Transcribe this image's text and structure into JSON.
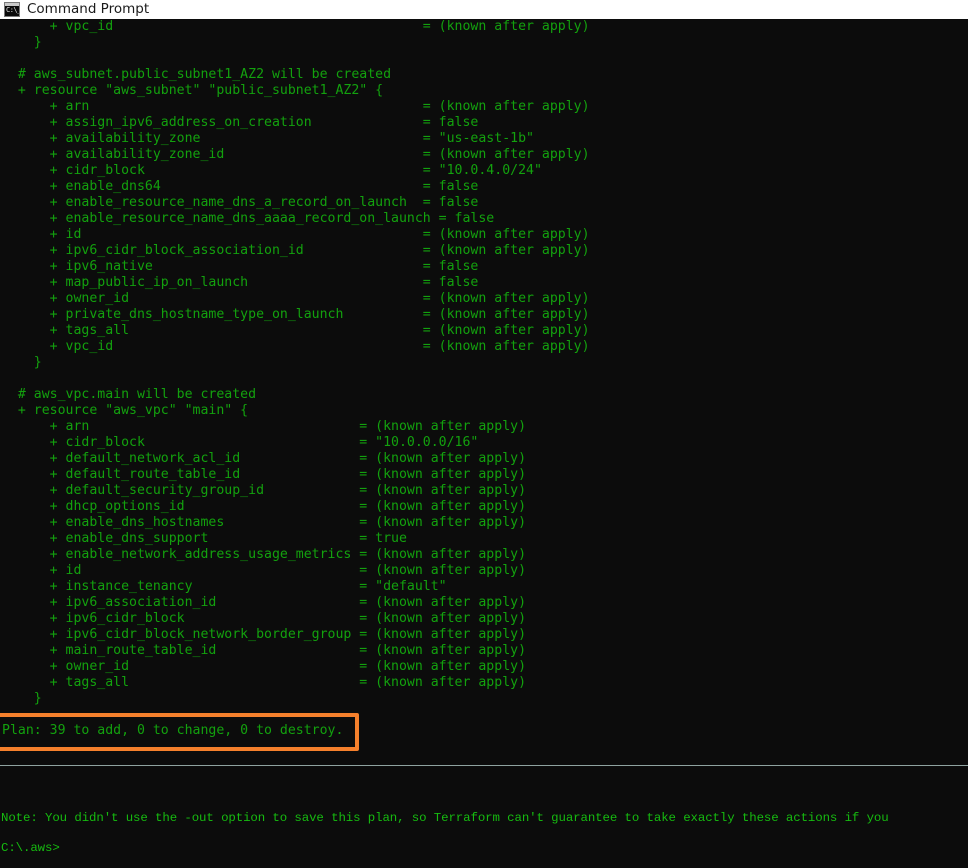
{
  "window": {
    "title": "Command Prompt",
    "icon": "command-prompt-icon",
    "icon_glyph": "C:\\_",
    "background": "#0c0c0c",
    "text_color": "#13a10e"
  },
  "terminal": {
    "lines": [
      "      + vpc_id                                       = (known after apply)",
      "    }",
      "",
      "  # aws_subnet.public_subnet1_AZ2 will be created",
      "  + resource \"aws_subnet\" \"public_subnet1_AZ2\" {",
      "      + arn                                          = (known after apply)",
      "      + assign_ipv6_address_on_creation              = false",
      "      + availability_zone                            = \"us-east-1b\"",
      "      + availability_zone_id                         = (known after apply)",
      "      + cidr_block                                   = \"10.0.4.0/24\"",
      "      + enable_dns64                                 = false",
      "      + enable_resource_name_dns_a_record_on_launch  = false",
      "      + enable_resource_name_dns_aaaa_record_on_launch = false",
      "      + id                                           = (known after apply)",
      "      + ipv6_cidr_block_association_id               = (known after apply)",
      "      + ipv6_native                                  = false",
      "      + map_public_ip_on_launch                      = false",
      "      + owner_id                                     = (known after apply)",
      "      + private_dns_hostname_type_on_launch          = (known after apply)",
      "      + tags_all                                     = (known after apply)",
      "      + vpc_id                                       = (known after apply)",
      "    }",
      "",
      "  # aws_vpc.main will be created",
      "  + resource \"aws_vpc\" \"main\" {",
      "      + arn                                  = (known after apply)",
      "      + cidr_block                           = \"10.0.0.0/16\"",
      "      + default_network_acl_id               = (known after apply)",
      "      + default_route_table_id               = (known after apply)",
      "      + default_security_group_id            = (known after apply)",
      "      + dhcp_options_id                      = (known after apply)",
      "      + enable_dns_hostnames                 = (known after apply)",
      "      + enable_dns_support                   = true",
      "      + enable_network_address_usage_metrics = (known after apply)",
      "      + id                                   = (known after apply)",
      "      + instance_tenancy                     = \"default\"",
      "      + ipv6_association_id                  = (known after apply)",
      "      + ipv6_cidr_block                      = (known after apply)",
      "      + ipv6_cidr_block_network_border_group = (known after apply)",
      "      + main_route_table_id                  = (known after apply)",
      "      + owner_id                             = (known after apply)",
      "      + tags_all                             = (known after apply)",
      "    }",
      ""
    ],
    "plan_summary": "Plan: 39 to add, 0 to change, 0 to destroy.",
    "plan_counts": {
      "add": 39,
      "change": 0,
      "destroy": 0
    },
    "note": "Note: You didn't use the -out option to save this plan, so Terraform can't guarantee to take exactly these actions if you",
    "prompt": "C:\\.aws>"
  },
  "annotation": {
    "highlight_color": "#f5802c",
    "target": "plan-summary-line"
  }
}
